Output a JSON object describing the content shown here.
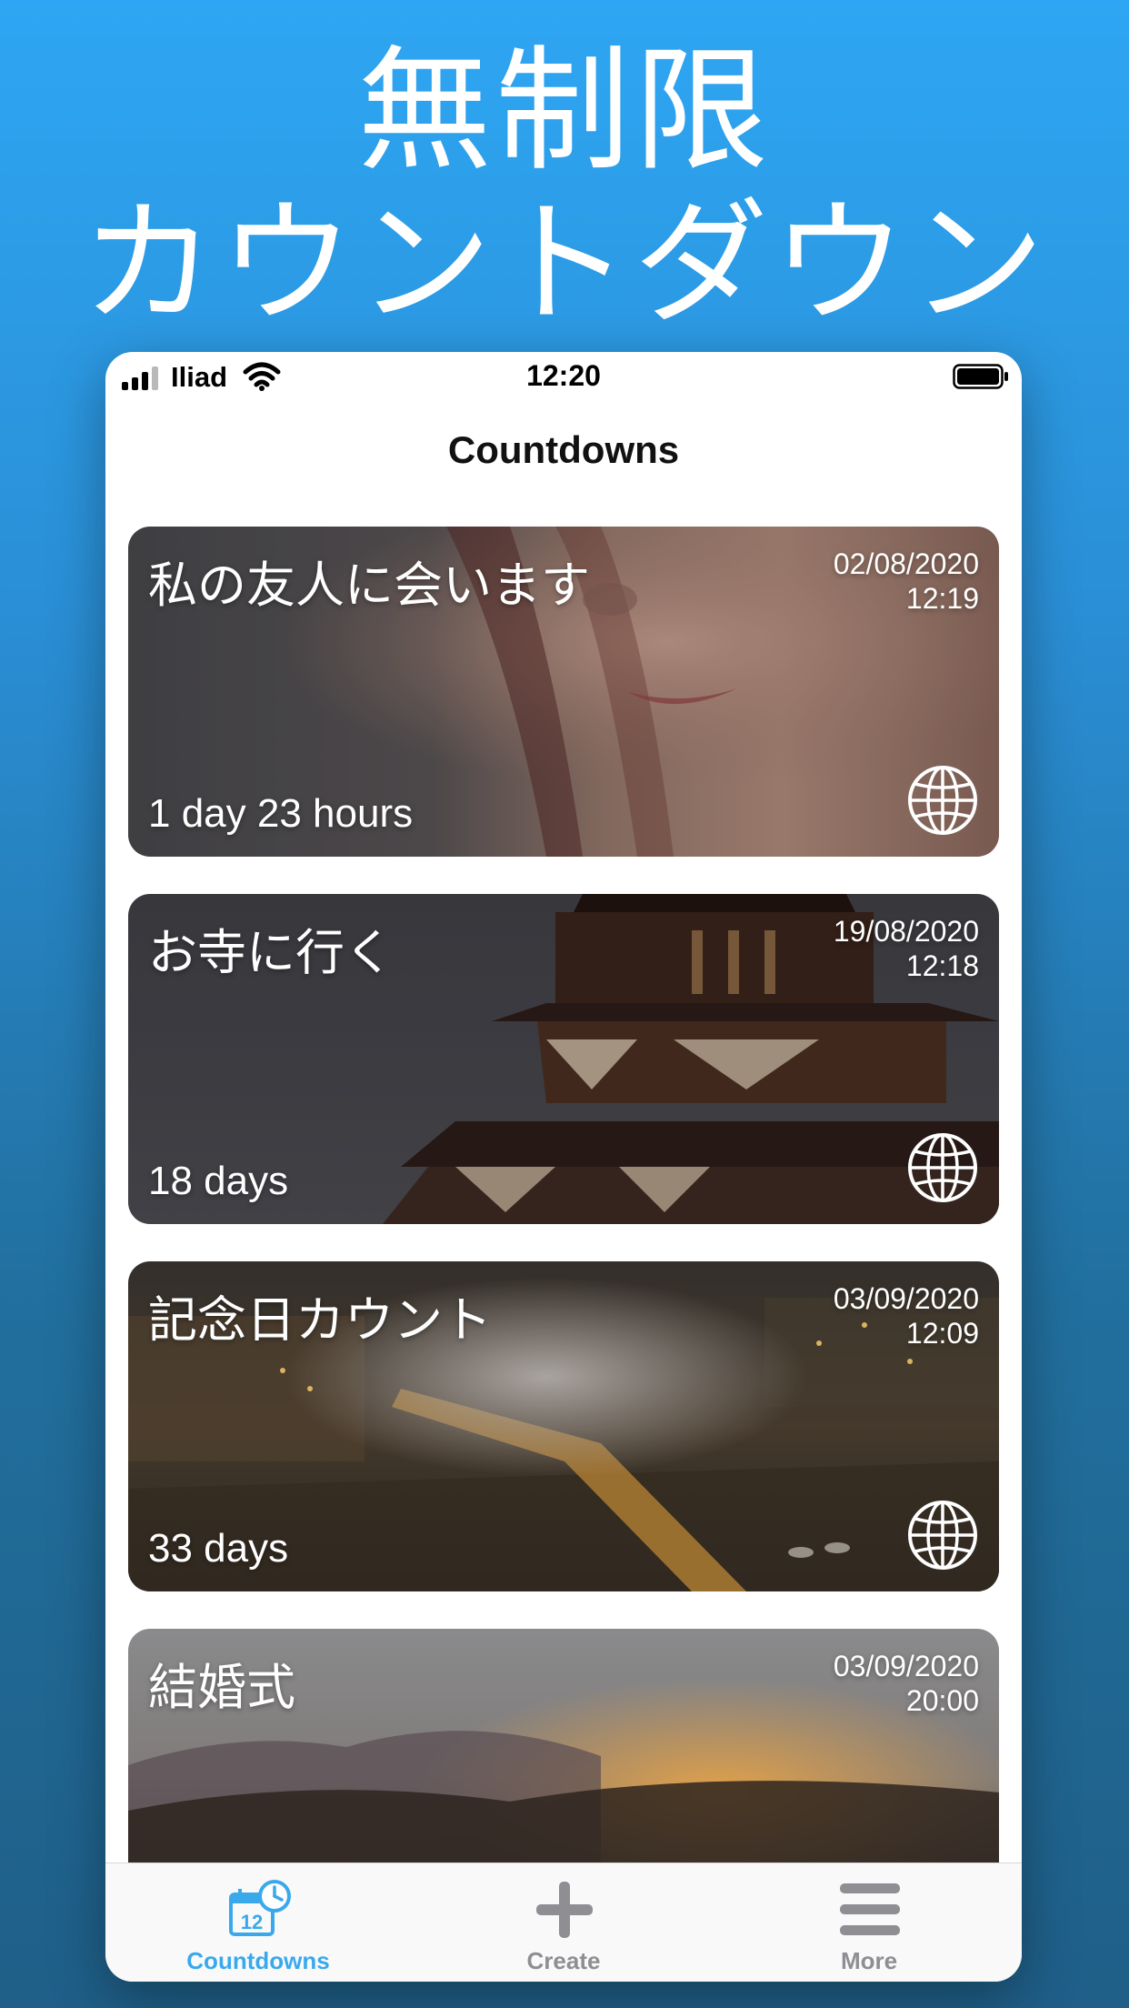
{
  "hero": {
    "line1": "無制限",
    "line2": "カウントダウン"
  },
  "status_bar": {
    "carrier": "Iliad",
    "time": "12:20"
  },
  "nav": {
    "title": "Countdowns"
  },
  "cards": [
    {
      "title": "私の友人に会います",
      "date": "02/08/2020",
      "time": "12:19",
      "remaining": "1 day 23 hours",
      "icon": "globe-icon"
    },
    {
      "title": "お寺に行く",
      "date": "19/08/2020",
      "time": "12:18",
      "remaining": "18 days",
      "icon": "globe-icon"
    },
    {
      "title": "記念日カウント",
      "date": "03/09/2020",
      "time": "12:09",
      "remaining": "33 days",
      "icon": "globe-icon"
    },
    {
      "title": "結婚式",
      "date": "03/09/2020",
      "time": "20:00",
      "remaining": "",
      "icon": ""
    }
  ],
  "tab_bar": {
    "tabs": [
      {
        "label": "Countdowns",
        "icon": "calendar-clock-icon",
        "active": true
      },
      {
        "label": "Create",
        "icon": "plus-icon",
        "active": false
      },
      {
        "label": "More",
        "icon": "menu-icon",
        "active": false
      }
    ]
  },
  "colors": {
    "background_top": "#2ea6f3",
    "background_bottom": "#1f5f88",
    "tab_active": "#3aa9ec",
    "tab_inactive": "#8e8e93"
  }
}
